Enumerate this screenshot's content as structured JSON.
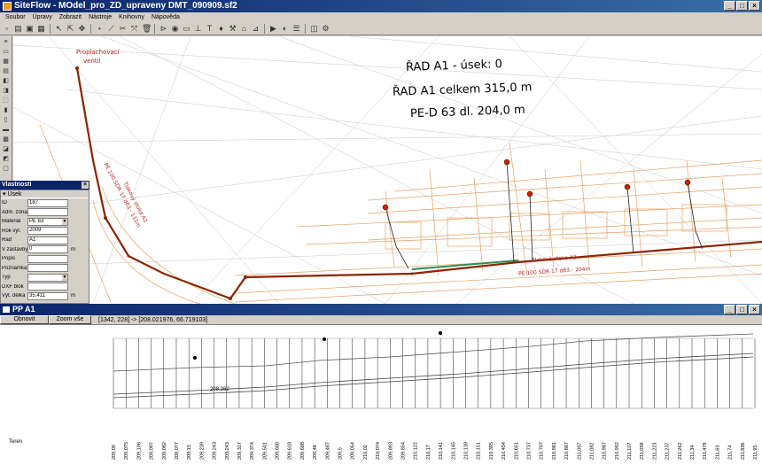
{
  "window": {
    "title": "SiteFlow - MOdel_pro_ZD_upraveny DMT_090909.sf2"
  },
  "menu": [
    "Soubor",
    "Úpravy",
    "Zobrazit",
    "Nástroje",
    "Knihovny",
    "Nápověda"
  ],
  "map": {
    "labels": {
      "valve": [
        "Proplachovací",
        "ventil"
      ],
      "header1": "ŘAD A1 - úsek: 0",
      "header2": "ŘAD A1 celkem 315,0 m",
      "header3": "PE-D 63 dl. 204,0 m",
      "pipe_left": "Tlakový stoka A1",
      "pipe_left2": "PE 100 SDR 17 d63 - 111m",
      "pipe_right": "Tlaková stoka A1",
      "pipe_right2": "PE 100 SDR 17 d63 - 204m"
    }
  },
  "properties": {
    "title": "Vlastnosti",
    "section": "Úsek",
    "rows": [
      {
        "label": "ID",
        "value": "187",
        "unit": ""
      },
      {
        "label": "Adm. zóna",
        "value": "",
        "unit": ""
      },
      {
        "label": "Materiál",
        "value": "PE 63",
        "unit": "",
        "dropdown": true
      },
      {
        "label": "Rok výr.",
        "value": "2009",
        "unit": ""
      },
      {
        "label": "Řad",
        "value": "A1",
        "unit": ""
      },
      {
        "label": "V zástavby",
        "value": "0",
        "unit": "m"
      },
      {
        "label": "Popis",
        "value": "",
        "unit": ""
      },
      {
        "label": "Poznámka",
        "value": "",
        "unit": ""
      },
      {
        "label": "Typ",
        "value": "",
        "unit": "",
        "dropdown": true
      },
      {
        "label": "DXF blok",
        "value": "",
        "unit": ""
      },
      {
        "label": "Výt. délka",
        "value": "35,411",
        "unit": "m"
      }
    ]
  },
  "profile": {
    "title": "PP A1",
    "refresh": "Obnovit",
    "zoom": "Zoom vše",
    "coords": "[1342, 228] -> [208.021976, 66.719103]",
    "terrain_label": "Teren",
    "elev_label": "208,262",
    "ticks": [
      "209,09",
      "209,075",
      "209,106",
      "209,097",
      "209,082",
      "209,077",
      "209,15",
      "209,239",
      "209,243",
      "209,243",
      "209,317",
      "209,374",
      "209,501",
      "209,608",
      "209,618",
      "209,688",
      "209,46",
      "209,487",
      "209,5",
      "209,054",
      "210,02",
      "210,074",
      "209,893",
      "209,854",
      "210,122",
      "210,17",
      "210,141",
      "210,145",
      "210,139",
      "210,151",
      "210,395",
      "210,454",
      "210,651",
      "210,737",
      "210,707",
      "210,881",
      "210,887",
      "211,007",
      "211,082",
      "210,987",
      "210,992",
      "211,107",
      "211,059",
      "211,223",
      "211,237",
      "211,262",
      "211,34",
      "211,478",
      "211,63",
      "211,74",
      "211,836",
      "211,95"
    ]
  },
  "colors": {
    "pipe": "#8b2500",
    "green_pipe": "#2e8b57",
    "contour": "#e8a060",
    "title_dark": "#0a246a"
  }
}
